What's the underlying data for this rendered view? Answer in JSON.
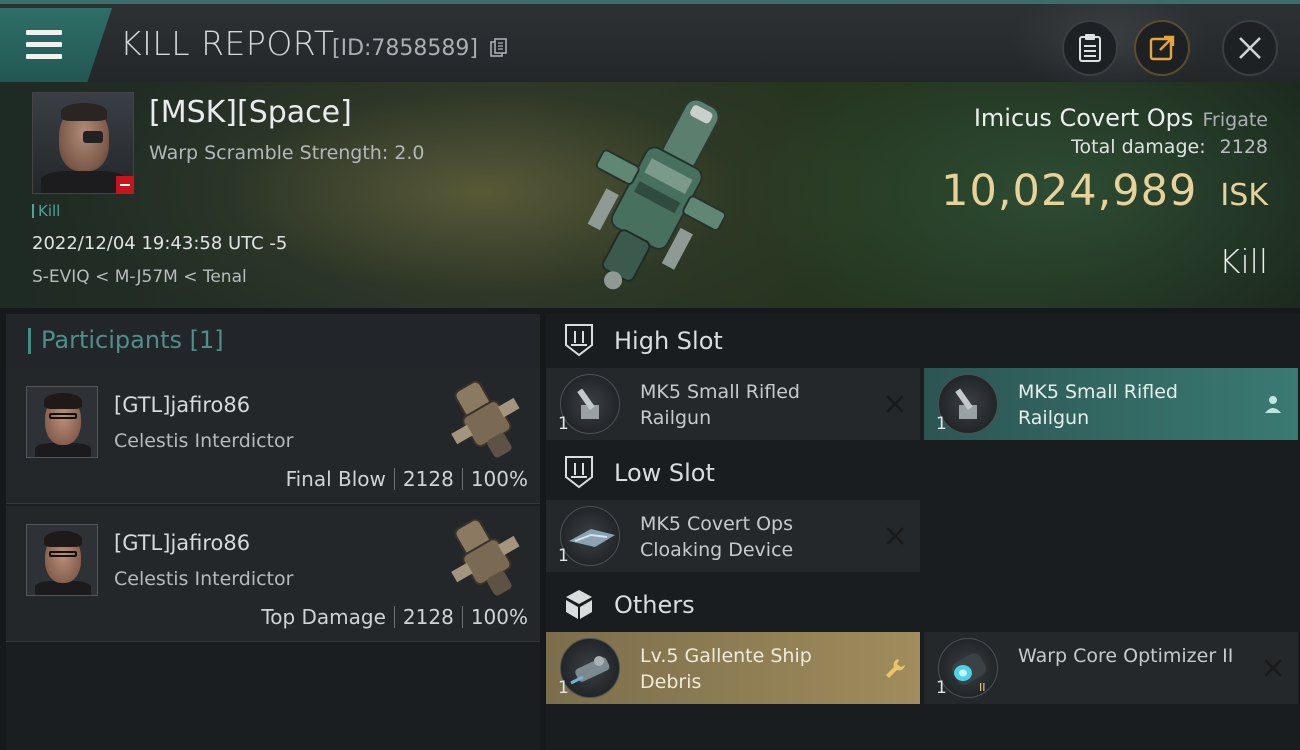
{
  "header": {
    "title": "KILL REPORT",
    "report_id": "[ID:7858589]"
  },
  "victim": {
    "name": "[MSK][Space]",
    "warp_scramble": "Warp Scramble Strength: 2.0",
    "kill_count": "Kill",
    "datetime": "2022/12/04 19:43:58 UTC -5",
    "location": "S-EVIQ < M-J57M < Tenal"
  },
  "ship": {
    "name": "Imicus Covert Ops",
    "class": "Frigate",
    "damage_label": "Total damage:",
    "damage_value": "2128",
    "isk_value": "10,024,989",
    "isk_unit": "ISK",
    "result": "Kill"
  },
  "participants": {
    "label": "Participants",
    "count": "[1]",
    "rows": [
      {
        "name": "[GTL]jafiro86",
        "ship": "Celestis Interdictor",
        "role": "Final Blow",
        "damage": "2128",
        "percent": "100%"
      },
      {
        "name": "[GTL]jafiro86",
        "ship": "Celestis Interdictor",
        "role": "Top Damage",
        "damage": "2128",
        "percent": "100%"
      }
    ]
  },
  "slots": {
    "high": {
      "label": "High Slot",
      "items": [
        {
          "name": "MK5 Small Rifled Railgun",
          "qty": "1",
          "state": "destroyed",
          "icon": "railgun-icon"
        },
        {
          "name": "MK5 Small Rifled Railgun",
          "qty": "1",
          "state": "dropped",
          "icon": "railgun-icon"
        }
      ]
    },
    "low": {
      "label": "Low Slot",
      "items": [
        {
          "name": "MK5 Covert Ops Cloaking Device",
          "qty": "1",
          "state": "destroyed",
          "icon": "cloak-icon"
        }
      ]
    },
    "others": {
      "label": "Others",
      "items": [
        {
          "name": "Lv.5 Gallente Ship Debris",
          "qty": "1",
          "state": "salvage",
          "icon": "debris-icon"
        },
        {
          "name": "Warp Core Optimizer II",
          "qty": "1",
          "state": "destroyed",
          "icon": "warp-core-icon"
        }
      ]
    }
  },
  "colors": {
    "accent_teal": "#3a7a73",
    "isk_gold": "#e7d29a",
    "loss_red": "#c4161c"
  }
}
